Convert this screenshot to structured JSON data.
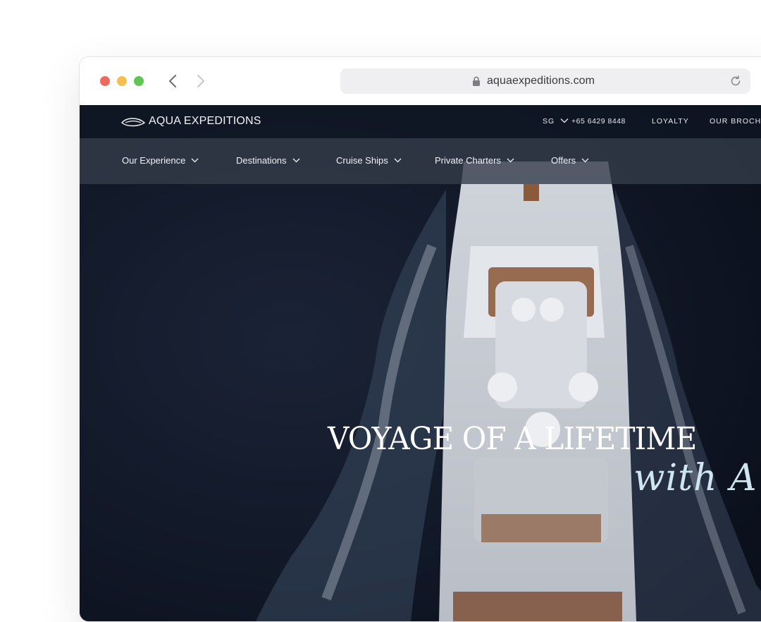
{
  "browser": {
    "url": "aquaexpeditions.com",
    "icons": {
      "back": "chevron-left-icon",
      "forward": "chevron-right-icon",
      "lock": "lock-icon",
      "reload": "reload-icon"
    }
  },
  "site": {
    "logo_text": "AQUA EXPEDITIONS",
    "utility_nav": {
      "region": "SG",
      "phone": "+65 6429 8448",
      "loyalty": "LOYALTY",
      "brochure": "OUR BROCHU"
    },
    "main_nav": [
      {
        "label": "Our Experience"
      },
      {
        "label": "Destinations"
      },
      {
        "label": "Cruise Ships"
      },
      {
        "label": "Private Charters"
      },
      {
        "label": "Offers"
      }
    ],
    "hero": {
      "headline": "VOYAGE OF A LIFETIME",
      "script": "with A"
    }
  },
  "colors": {
    "traffic_red": "#ee6a5e",
    "traffic_yellow": "#f5bf4f",
    "traffic_green": "#61c554",
    "sea_dark": "#0c1220",
    "nav_bar": "#343c4a"
  }
}
